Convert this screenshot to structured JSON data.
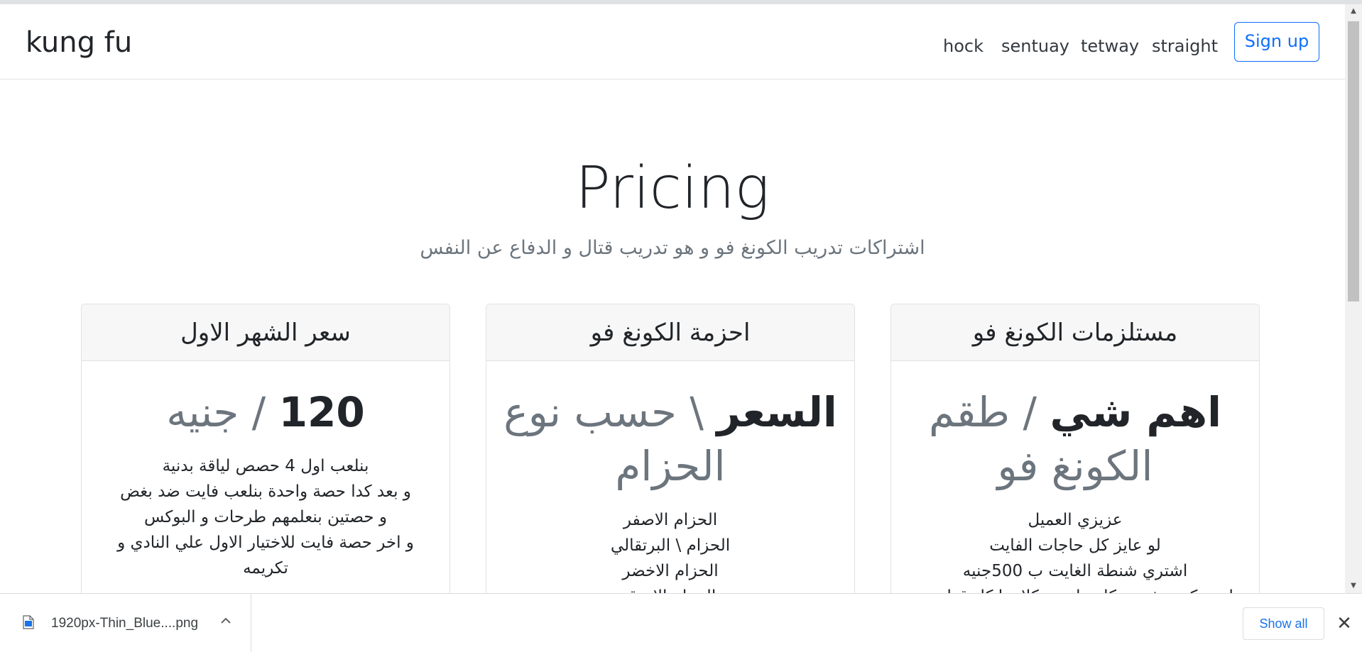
{
  "navbar": {
    "brand": "kung fu",
    "links": [
      "hock",
      "sentuay",
      "tetway",
      "straight"
    ],
    "signup_label": "Sign up"
  },
  "hero": {
    "title": "Pricing",
    "subtitle": "اشتراكات تدريب الكونغ فو و هو تدريب قتال و الدفاع عن النفس"
  },
  "cards": [
    {
      "header": "مستلزمات الكونغ فو",
      "title_strong": "اهم شي",
      "title_muted": " / طقم الكونغ فو",
      "items": [
        "عزيزي العميل",
        "لو عايز كل حاجات الفايت",
        "اشتري شنطة الغايت ب 500جنيه",
        "ليس كده تشتري كل حاجة و كلاهما كل قطعة و"
      ]
    },
    {
      "header": "احزمة الكونغ فو",
      "title_strong": "السعر",
      "title_muted": " \\ حسب نوع الحزام",
      "items": [
        "الحزام الاصفر",
        "الحزام \\ البرتقالي",
        "الحزام الاخضر",
        "الحزام الازرق"
      ]
    },
    {
      "header": "سعر الشهر الاول",
      "title_strong": "120",
      "title_muted": " / جنيه",
      "items": [
        "بنلعب اول 4 حصص لياقة بدنية",
        "و بعد كدا حصة واحدة بنلعب فايت ضد بغض",
        "و حصتين بنعلمهم طرحات و البوكس",
        "و اخر حصة فايت للاختيار الاول علي النادي و تكريمه"
      ]
    }
  ],
  "download_bar": {
    "file_name": "1920px-Thin_Blue....png",
    "show_all_label": "Show all",
    "close_label": "✕"
  },
  "icons": {
    "file": "file-image-icon",
    "chevron": "chevron-up-icon",
    "close": "close-icon"
  },
  "colors": {
    "accent": "#0d6efd",
    "muted": "#6c757d",
    "chrome_blue": "#1a73e8"
  }
}
